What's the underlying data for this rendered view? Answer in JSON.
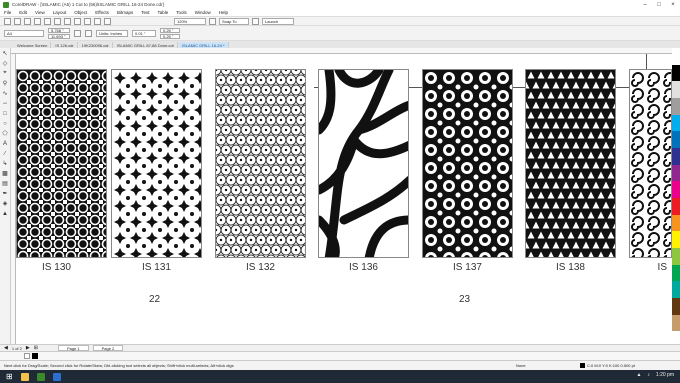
{
  "app": {
    "title": "CorelDRAW - [\\ISLAMIC (A5) 1 Cut to (56)\\ISLAMIC GRILL 16-24 Done.cdr]"
  },
  "menu": [
    "File",
    "Edit",
    "View",
    "Layout",
    "Object",
    "Effects",
    "Bitmaps",
    "Text",
    "Table",
    "Tools",
    "Window",
    "Help"
  ],
  "toolbar": {
    "zoom": "120%",
    "snap": "Snap To",
    "launch": "Launch"
  },
  "propbar": {
    "page_size": "A4",
    "width": "5.768 \"",
    "height": "11.693 \"",
    "units": "Units: Inches",
    "nudge": "0.01 \"",
    "dup_x": "0.25 \"",
    "dup_y": "0.25 \""
  },
  "tabs": [
    "Welcome Screen",
    "IS 126.cdr",
    "19K230096.cdr",
    "ISLAMIC GRILL 87-88 Done.cdr",
    "ISLAMIC GRILL 16-24 *"
  ],
  "panels": [
    {
      "label": "IS 130",
      "pattern": "grid-circles"
    },
    {
      "label": "IS 131",
      "pattern": "floral"
    },
    {
      "label": "IS 132",
      "pattern": "stars"
    },
    {
      "label": "IS 136",
      "pattern": "branches"
    },
    {
      "label": "IS 137",
      "pattern": "ornate"
    },
    {
      "label": "IS 138",
      "pattern": "triangles"
    },
    {
      "label": "IS",
      "pattern": "swirls"
    }
  ],
  "page_numbers": [
    "22",
    "23"
  ],
  "pager": {
    "count": "1 of 2",
    "pages": [
      "Page 1",
      "Page 2"
    ]
  },
  "status": {
    "hint": "Next click for Drag/Scale; Second click for Rotate/Skew; Dbl-clicking tool selects all objects; Shift+click multi-selects; Alt+click digs",
    "fill": "None",
    "color_info": "C:0 M:0 Y:0 K:100  0.500 pt"
  },
  "clock": "1:20 pm",
  "colors": {
    "accent": "#0b4f9c",
    "panel_black": "#111111"
  }
}
